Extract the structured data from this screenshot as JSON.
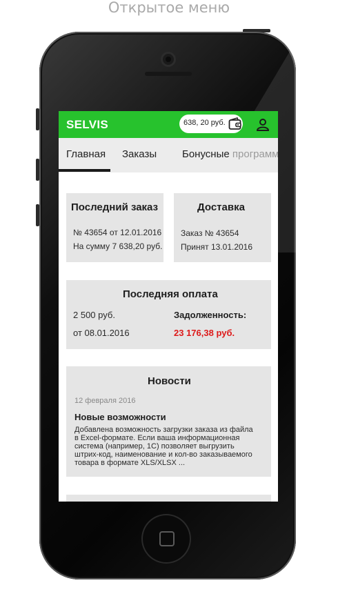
{
  "caption": "Открытое меню",
  "app": {
    "brand": "SELVIS",
    "balance": "638, 20 руб.",
    "colors": {
      "accent": "#27c22d",
      "debt": "#dd1b1b"
    }
  },
  "tabs": [
    {
      "label": "Главная",
      "active": true
    },
    {
      "label": "Заказы"
    },
    {
      "label_a": "Бонусные",
      "label_b": "программ"
    }
  ],
  "cards": {
    "last_order": {
      "title": "Последний заказ",
      "number": "№ 43654 от 12.01.2016",
      "sum": "На сумму 7 638,20 руб."
    },
    "delivery": {
      "title": "Доставка",
      "order": "Заказ № 43654",
      "status": "Принят 13.01.2016"
    },
    "payment": {
      "title": "Последняя оплата",
      "amount": "2 500 руб.",
      "date": "от 08.01.2016",
      "debt_label": "Задолженность:",
      "debt_value": "23 176,38 руб."
    },
    "news": {
      "title": "Новости",
      "date": "12 февраля 2016",
      "headline": "Новые возможности",
      "lines": [
        "Добавлена возможность загрузки заказа из файла",
        "в Excel-формате. Если ваша информационная",
        "система (например, 1С) позволяет выгрузить",
        "штрих-код, наименование и кол-во заказываемого",
        "товара в формате XLS/XLSX ..."
      ]
    }
  },
  "icons": {
    "wallet": "wallet-icon",
    "profile": "user-icon"
  }
}
